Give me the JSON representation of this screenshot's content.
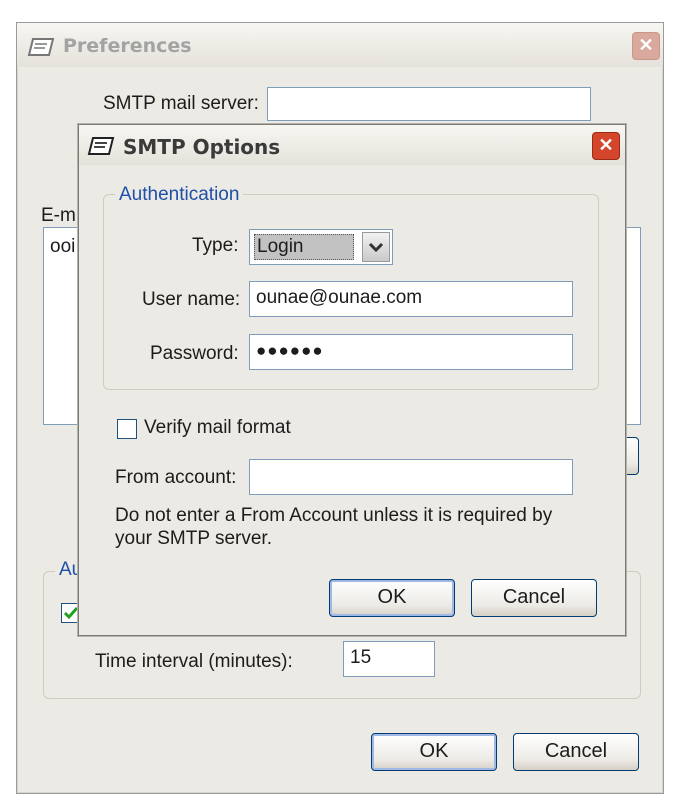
{
  "preferences": {
    "title": "Preferences",
    "smtp_server_label": "SMTP mail server:",
    "smtp_server_value": "",
    "email_label_partial": "E-m",
    "email_list_item_partial": "ooi",
    "auto_group_legend_partial": "Au",
    "auto_check_checked": true,
    "time_interval_label": "Time interval (minutes):",
    "time_interval_value": "15",
    "ok_label": "OK",
    "cancel_label": "Cancel"
  },
  "smtp_options": {
    "title": "SMTP Options",
    "authentication_legend": "Authentication",
    "type_label": "Type:",
    "type_value": "Login",
    "username_label": "User name:",
    "username_value": "ounae@ounae.com",
    "password_label": "Password:",
    "password_value": "●●●●●●",
    "verify_label": "Verify mail format",
    "verify_checked": false,
    "from_account_label": "From account:",
    "from_account_value": "",
    "note_line1": "Do not enter a From Account unless it is required by",
    "note_line2": "your SMTP server.",
    "ok_label": "OK",
    "cancel_label": "Cancel"
  },
  "icons": {
    "app": "app-icon",
    "close": "close-icon",
    "dropdown": "chevron-down-icon",
    "check": "check-icon"
  },
  "colors": {
    "title_text_inactive": "#a3a3a3",
    "title_text_active": "#3a3a3a",
    "close_inactive": "#d9a99d",
    "close_active": "#d3462b",
    "legend": "#1f4fa8",
    "field_border": "#7f9db9",
    "select_highlight": "#c2c2c2"
  }
}
